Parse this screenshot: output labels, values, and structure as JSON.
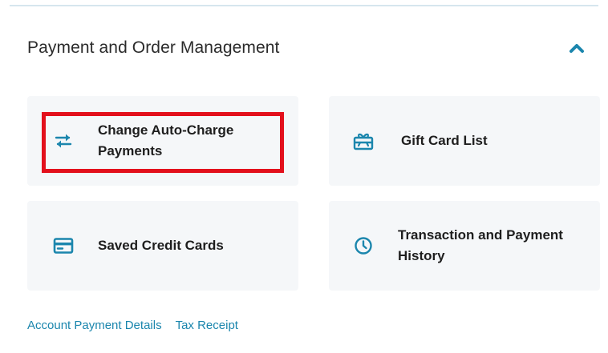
{
  "section": {
    "title": "Payment and Order Management",
    "toggle_icon": "chevron-up-icon"
  },
  "tiles": [
    {
      "label": "Change Auto-Charge\nPayments",
      "icon": "swap-arrows-icon"
    },
    {
      "label": "Gift Card List",
      "icon": "gift-card-icon"
    },
    {
      "label": "Saved Credit Cards",
      "icon": "credit-card-icon"
    },
    {
      "label": "Transaction and Payment\nHistory",
      "icon": "clock-icon"
    }
  ],
  "footer_links": [
    {
      "label": "Account Payment Details"
    },
    {
      "label": "Tax Receipt"
    }
  ],
  "colors": {
    "accent": "#1b86ad",
    "tile_background": "#f5f7f9",
    "highlight": "#e3101c"
  }
}
